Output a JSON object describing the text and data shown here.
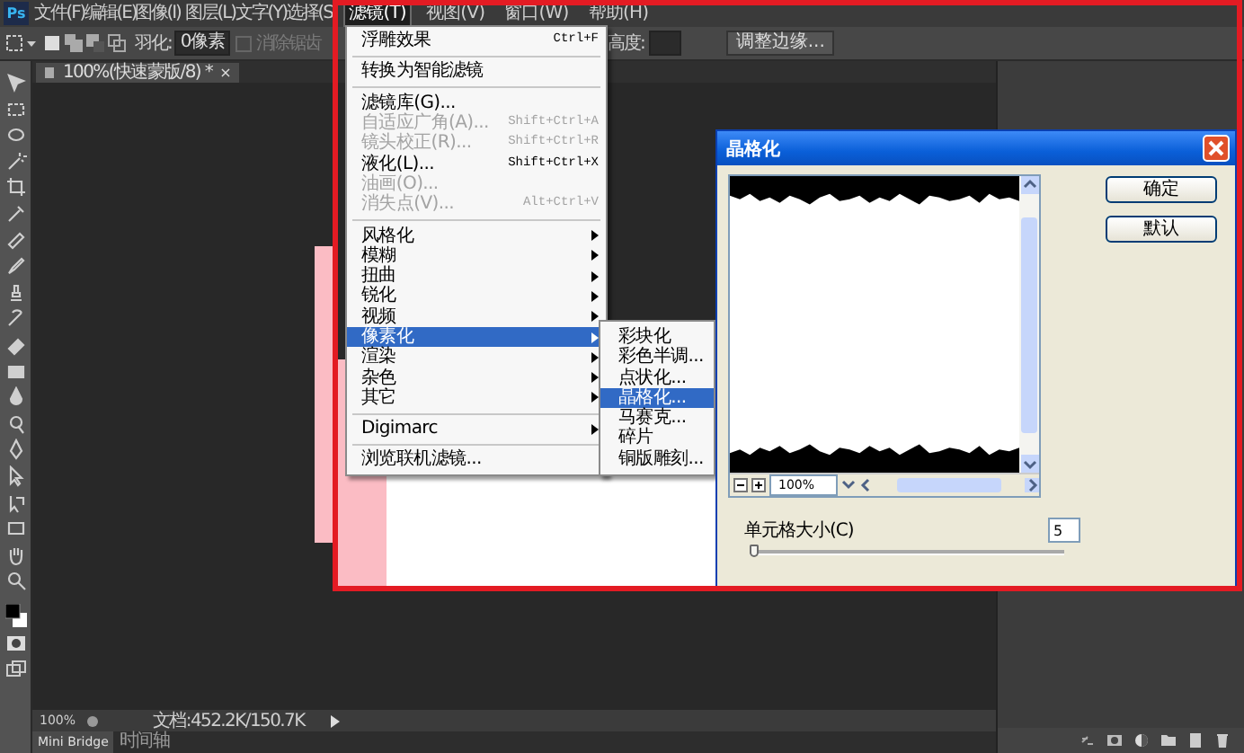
{
  "app": {
    "logo": "Ps"
  },
  "menubar": [
    {
      "label": "文件(F)",
      "selected": false
    },
    {
      "label": "编辑(E)",
      "selected": false
    },
    {
      "label": "图像(I)",
      "selected": false
    },
    {
      "label": "图层(L)",
      "selected": false
    },
    {
      "label": "文字(Y)",
      "selected": false
    },
    {
      "label": "选择(S",
      "selected": false
    },
    {
      "label": "滤镜(T)",
      "selected": true
    },
    {
      "label": "视图(V)",
      "selected": false
    },
    {
      "label": "窗口(W)",
      "selected": false
    },
    {
      "label": "帮助(H)",
      "selected": false
    }
  ],
  "options_bar": {
    "feather_label": "羽化:",
    "feather_value": "0像素",
    "antialias": {
      "label": "消除锯齿",
      "checked": false,
      "disabled": true
    },
    "height_label": "高度:",
    "refine_button": "调整边缘..."
  },
  "document_tab": {
    "title": "100%(快速蒙版/8) *",
    "close": "×"
  },
  "filter_menu": {
    "items": [
      {
        "kind": "item",
        "label": "浮雕效果",
        "shortcut": "Ctrl+F",
        "disabled": false,
        "selected": false,
        "submenu": false
      },
      {
        "kind": "separator"
      },
      {
        "kind": "item",
        "label": "转换为智能滤镜",
        "disabled": false,
        "selected": false,
        "submenu": false
      },
      {
        "kind": "separator"
      },
      {
        "kind": "item",
        "label": "滤镜库(G)...",
        "disabled": false,
        "selected": false,
        "submenu": false
      },
      {
        "kind": "item",
        "label": "自适应广角(A)...",
        "shortcut": "Shift+Ctrl+A",
        "disabled": true,
        "selected": false,
        "submenu": false
      },
      {
        "kind": "item",
        "label": "镜头校正(R)...",
        "shortcut": "Shift+Ctrl+R",
        "disabled": true,
        "selected": false,
        "submenu": false
      },
      {
        "kind": "item",
        "label": "液化(L)...",
        "shortcut": "Shift+Ctrl+X",
        "disabled": false,
        "selected": false,
        "submenu": false
      },
      {
        "kind": "item",
        "label": "油画(O)...",
        "disabled": true,
        "selected": false,
        "submenu": false
      },
      {
        "kind": "item",
        "label": "消失点(V)...",
        "shortcut": "Alt+Ctrl+V",
        "disabled": true,
        "selected": false,
        "submenu": false
      },
      {
        "kind": "separator"
      },
      {
        "kind": "item",
        "label": "风格化",
        "disabled": false,
        "selected": false,
        "submenu": true
      },
      {
        "kind": "item",
        "label": "模糊",
        "disabled": false,
        "selected": false,
        "submenu": true
      },
      {
        "kind": "item",
        "label": "扭曲",
        "disabled": false,
        "selected": false,
        "submenu": true
      },
      {
        "kind": "item",
        "label": "锐化",
        "disabled": false,
        "selected": false,
        "submenu": true
      },
      {
        "kind": "item",
        "label": "视频",
        "disabled": false,
        "selected": false,
        "submenu": true
      },
      {
        "kind": "item",
        "label": "像素化",
        "disabled": false,
        "selected": true,
        "submenu": true
      },
      {
        "kind": "item",
        "label": "渲染",
        "disabled": false,
        "selected": false,
        "submenu": true
      },
      {
        "kind": "item",
        "label": "杂色",
        "disabled": false,
        "selected": false,
        "submenu": true
      },
      {
        "kind": "item",
        "label": "其它",
        "disabled": false,
        "selected": false,
        "submenu": true
      },
      {
        "kind": "separator"
      },
      {
        "kind": "item",
        "label": "Digimarc",
        "disabled": false,
        "selected": false,
        "submenu": true
      },
      {
        "kind": "separator"
      },
      {
        "kind": "item",
        "label": "浏览联机滤镜...",
        "disabled": false,
        "selected": false,
        "submenu": false
      }
    ]
  },
  "submenu": {
    "items": [
      {
        "label": "彩块化",
        "selected": false
      },
      {
        "label": "彩色半调...",
        "selected": false
      },
      {
        "label": "点状化...",
        "selected": false
      },
      {
        "label": "晶格化...",
        "selected": true
      },
      {
        "label": "马赛克...",
        "selected": false
      },
      {
        "label": "碎片",
        "selected": false
      },
      {
        "label": "铜版雕刻...",
        "selected": false
      }
    ]
  },
  "dialog": {
    "title": "晶格化",
    "zoom": "100%",
    "cell_size_label": "单元格大小(C)",
    "cell_size": "5",
    "level": 0.01,
    "buttons": [
      "确定",
      "默认"
    ]
  },
  "status_bar": {
    "zoom": "100%",
    "doc_info": "文档:452.2K/150.7K"
  },
  "bottom_tabs": [
    {
      "label": "Mini Bridge",
      "selected": true
    },
    {
      "label": "时间轴",
      "selected": false
    }
  ]
}
